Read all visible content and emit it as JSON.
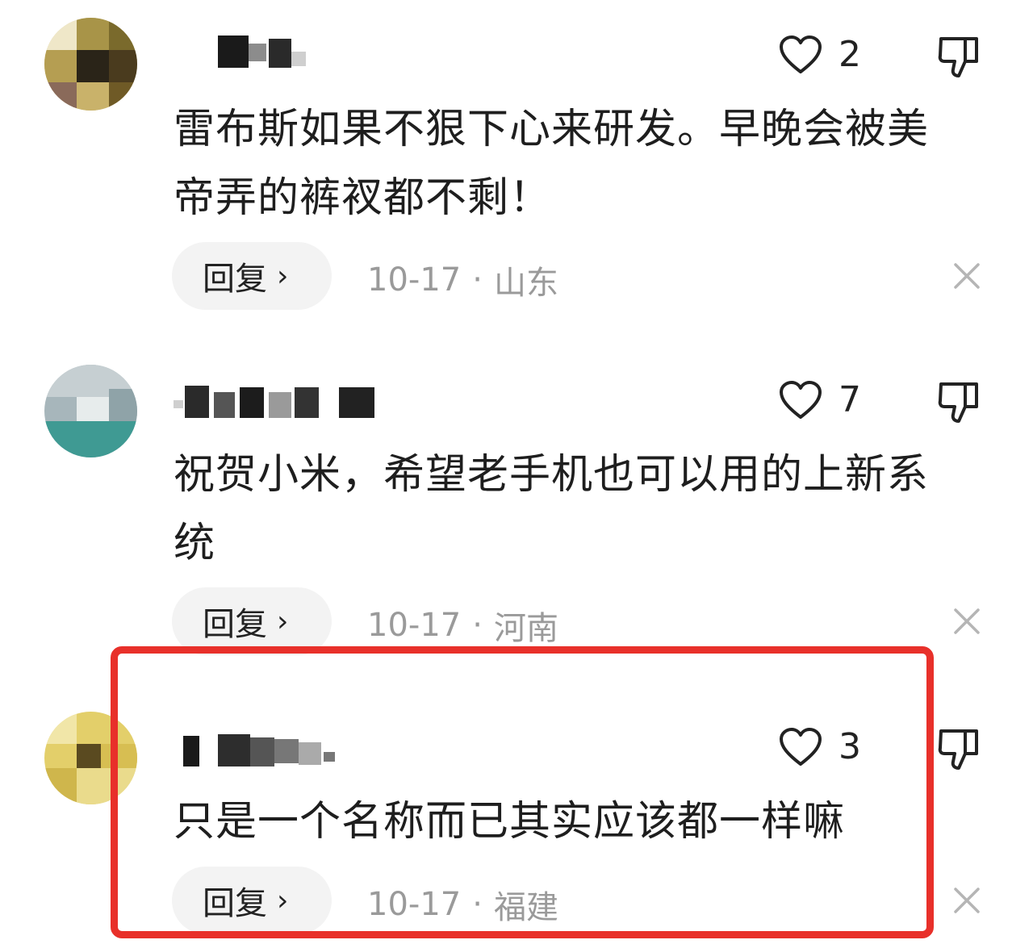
{
  "comments": [
    {
      "likes": "2",
      "text": "雷布斯如果不狠下心来研发。早晚会被美帝弄的裤衩都不剩！",
      "reply_label": "回复",
      "reply_chevron": "›",
      "date": "10-17",
      "separator": "·",
      "location": "山东"
    },
    {
      "likes": "7",
      "text": "祝贺小米，希望老手机也可以用的上新系统",
      "reply_label": "回复",
      "reply_chevron": "›",
      "date": "10-17",
      "separator": "·",
      "location": "河南"
    },
    {
      "likes": "3",
      "text": "只是一个名称而已其实应该都一样嘛",
      "reply_label": "回复",
      "reply_chevron": "›",
      "date": "10-17",
      "separator": "·",
      "location": "福建"
    }
  ],
  "icons": {
    "like": "heart-outline-icon",
    "dislike": "thumbs-down-icon",
    "close": "close-icon"
  },
  "colors": {
    "highlight_border": "#e8302a",
    "meta_text": "#9a9a9a",
    "reply_bg": "#f3f3f3"
  }
}
